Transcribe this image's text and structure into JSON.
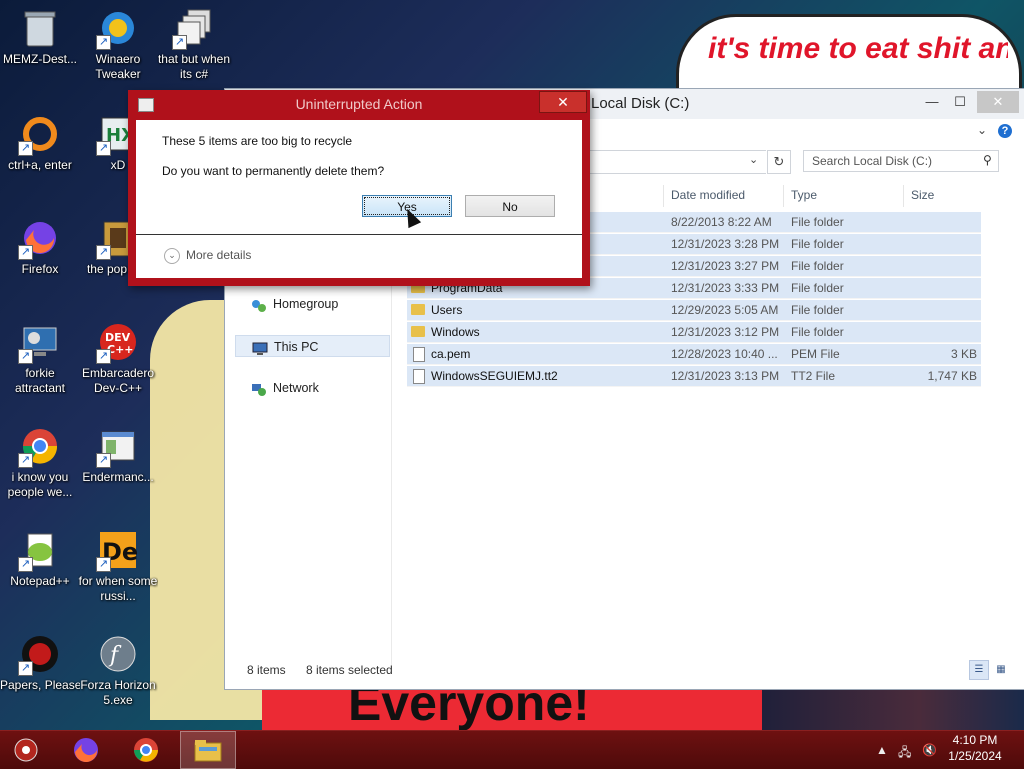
{
  "wallpaper": {
    "speech_text": "it's time to eat shit and die and celebrate",
    "banner_text": "Everyone!"
  },
  "desktop_icons": [
    {
      "label": "MEMZ-Dest...",
      "icon": "recycle-bin-icon"
    },
    {
      "label": "Winaero Tweaker",
      "icon": "winaero-icon"
    },
    {
      "label": "that but when its c#",
      "icon": "stack-windows-icon"
    },
    {
      "label": "ctrl+a, enter",
      "icon": "ring-icon"
    },
    {
      "label": "xD",
      "icon": "hxd-icon"
    },
    {
      "label": "Firefox",
      "icon": "firefox-icon"
    },
    {
      "label": "the pop shit",
      "icon": "image-icon"
    },
    {
      "label": "forkie attractant",
      "icon": "monitor-gear-icon"
    },
    {
      "label": "Embarcadero Dev-C++",
      "icon": "devcpp-icon"
    },
    {
      "label": "i know you people we...",
      "icon": "chrome-icon"
    },
    {
      "label": "Endermanc...",
      "icon": "window-icon"
    },
    {
      "label": "Notepad++",
      "icon": "notepadpp-icon"
    },
    {
      "label": "for when some russi...",
      "icon": "de-icon"
    },
    {
      "label": "Papers, Please",
      "icon": "papers-please-icon"
    },
    {
      "label": "Forza Horizon 5.exe",
      "icon": "flash-icon"
    }
  ],
  "explorer": {
    "title": "Local Disk (C:)",
    "search_placeholder": "Search Local Disk (C:)",
    "nav": [
      "Homegroup",
      "This PC",
      "Network"
    ],
    "columns": {
      "date": "Date modified",
      "type": "Type",
      "size": "Size"
    },
    "files": [
      {
        "name": "",
        "date": "8/22/2013 8:22 AM",
        "type": "File folder",
        "size": "",
        "kind": "folder"
      },
      {
        "name": "",
        "date": "12/31/2023 3:28 PM",
        "type": "File folder",
        "size": "",
        "kind": "folder"
      },
      {
        "name": "",
        "date": "12/31/2023 3:27 PM",
        "type": "File folder",
        "size": "",
        "kind": "folder"
      },
      {
        "name": "ProgramData",
        "date": "12/31/2023 3:33 PM",
        "type": "File folder",
        "size": "",
        "kind": "folder"
      },
      {
        "name": "Users",
        "date": "12/29/2023 5:05 AM",
        "type": "File folder",
        "size": "",
        "kind": "folder"
      },
      {
        "name": "Windows",
        "date": "12/31/2023 3:12 PM",
        "type": "File folder",
        "size": "",
        "kind": "folder"
      },
      {
        "name": "ca.pem",
        "date": "12/28/2023 10:40 ...",
        "type": "PEM File",
        "size": "3 KB",
        "kind": "file"
      },
      {
        "name": "WindowsSEGUIEMJ.tt2",
        "date": "12/31/2023 3:13 PM",
        "type": "TT2 File",
        "size": "1,747 KB",
        "kind": "file"
      }
    ],
    "status": {
      "items": "8 items",
      "selected": "8 items selected"
    }
  },
  "dialog": {
    "title": "Uninterrupted Action",
    "message1": "These 5 items are too big to recycle",
    "message2": "Do you want to permanently delete them?",
    "yes_label": "Yes",
    "no_label": "No",
    "more_details": "More details",
    "close_glyph": "✕"
  },
  "taskbar": {
    "time": "4:10 PM",
    "date": "1/25/2024"
  },
  "colors": {
    "taskbar": "#5c0d0d",
    "dialog_frame": "#b0111b",
    "selection": "#dbe7f6"
  }
}
